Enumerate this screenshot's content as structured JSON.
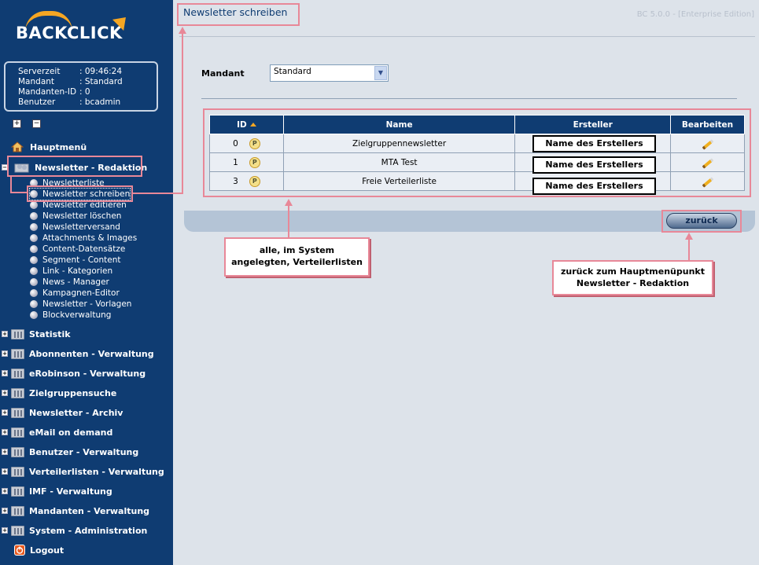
{
  "sidebar": {
    "logo_text": "BACKCLICK",
    "info": [
      {
        "key": "Serverzeit",
        "value": ": 09:46:24"
      },
      {
        "key": "Mandant",
        "value": ": Standard"
      },
      {
        "key": "Mandanten-ID",
        "value": ": 0"
      },
      {
        "key": "Benutzer",
        "value": ": bcadmin"
      }
    ],
    "expand_all": "+",
    "collapse_all": "−",
    "home_label": "Hauptmenü",
    "open_section_label": "Newsletter - Redaktion",
    "sub_items": [
      "Newsletterliste",
      "Newsletter schreiben",
      "Newsletter editieren",
      "Newsletter löschen",
      "Newsletterversand",
      "Attachments & Images",
      "Content-Datensätze",
      "Segment - Content",
      "Link - Kategorien",
      "News - Manager",
      "Kampagnen-Editor",
      "Newsletter - Vorlagen",
      "Blockverwaltung"
    ],
    "sections": [
      "Statistik",
      "Abonnenten - Verwaltung",
      "eRobinson - Verwaltung",
      "Zielgruppensuche",
      "Newsletter - Archiv",
      "eMail on demand",
      "Benutzer - Verwaltung",
      "Verteilerlisten - Verwaltung",
      "IMF - Verwaltung",
      "Mandanten - Verwaltung",
      "System - Administration"
    ],
    "logout_label": "Logout"
  },
  "header": {
    "title": "Newsletter schreiben",
    "version": "BC 5.0.0 - [Enterprise Edition]"
  },
  "form": {
    "mandant_label": "Mandant",
    "mandant_value": "Standard"
  },
  "table": {
    "headers": [
      "ID",
      "Name",
      "Ersteller",
      "Bearbeiten"
    ],
    "rows": [
      {
        "id": "0",
        "name": "Zielgruppennewsletter",
        "creator": "Name des Erstellers"
      },
      {
        "id": "1",
        "name": "MTA Test",
        "creator": "Name des Erstellers"
      },
      {
        "id": "3",
        "name": "Freie Verteilerliste",
        "creator": "Name des Erstellers"
      }
    ]
  },
  "back_button": "zurück",
  "annotations": {
    "lists_note_line1": "alle, im System",
    "lists_note_line2": "angelegten, Verteilerlisten",
    "back_note_line1": "zurück zum Hauptmenüpunkt",
    "back_note_line2": "Newsletter - Redaktion"
  },
  "colors": {
    "sidebar_bg": "#0f3c72",
    "accent": "#f5a623",
    "annotation": "#e88898"
  }
}
